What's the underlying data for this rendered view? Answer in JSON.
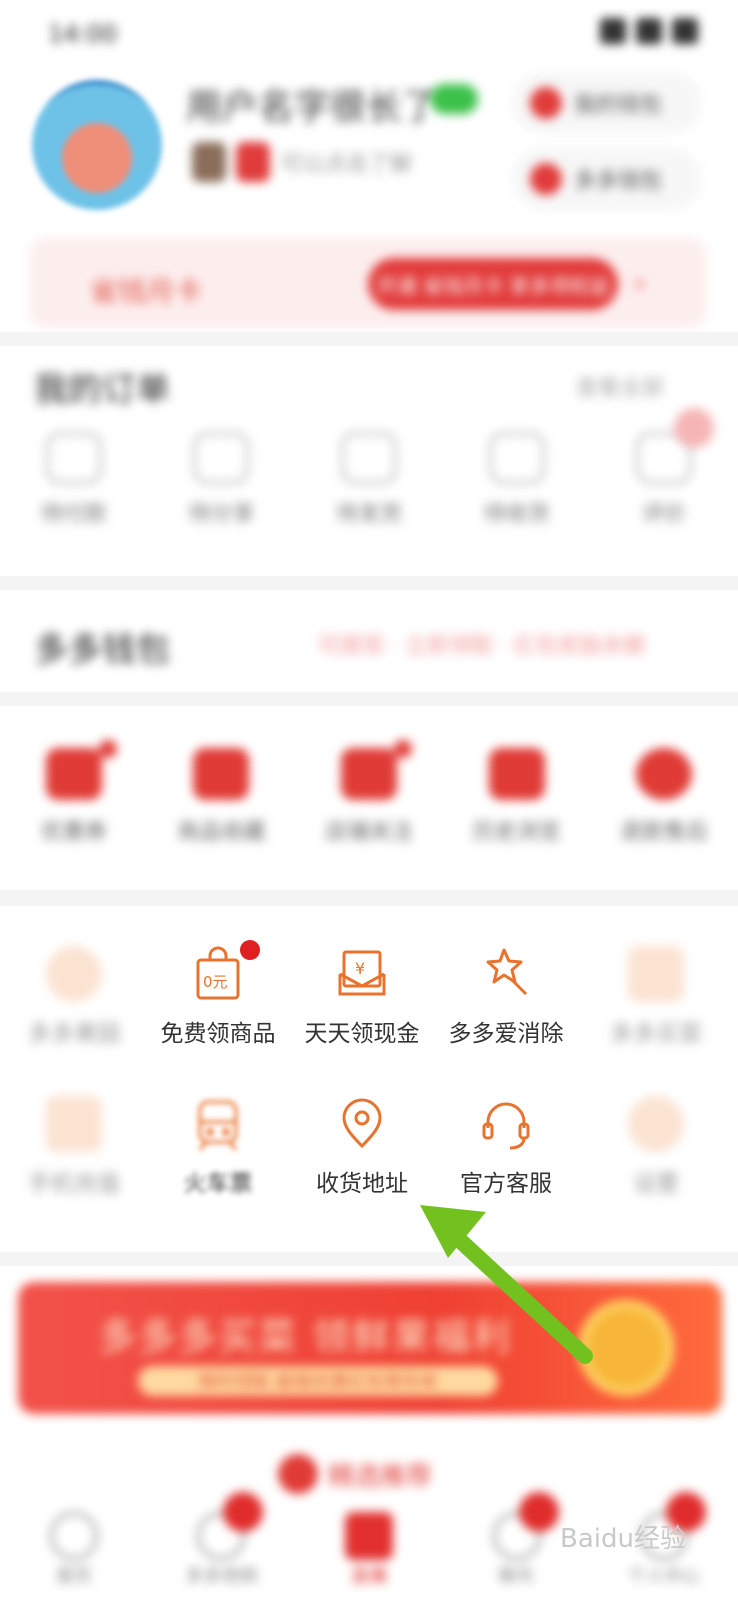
{
  "status_bar": {
    "time": "14:00"
  },
  "profile": {
    "nickname": "用户名字很长了",
    "sub_text": "可以点击了解",
    "pill_1": "我的钱包",
    "pill_2": "多多钱包"
  },
  "promo": {
    "text": "省钱月卡",
    "button": "开通 省钱月卡 享多项权益"
  },
  "orders": {
    "title": "我的订单",
    "view_all": "查看全部",
    "items": [
      "待付款",
      "待分享",
      "待发货",
      "待收货",
      "评价"
    ]
  },
  "duoduo": {
    "title": "多多钱包",
    "tags": "可提现 · 立即领取 · 红包奖励余额"
  },
  "quick_row": {
    "items": [
      "优惠券",
      "商品收藏",
      "店铺关注",
      "历史浏览",
      "退款售后"
    ]
  },
  "services": {
    "row1": [
      "多多果园",
      "免费领商品",
      "天天领现金",
      "多多爱消除",
      "多多买菜"
    ],
    "row2": [
      "手机充值",
      "火车票",
      "收货地址",
      "官方客服",
      "设置"
    ]
  },
  "big_banner": {
    "title": "多多多买菜 领鲜果福利",
    "strip": "限时领取 超值优惠红包等你来"
  },
  "recommend": "精选推荐",
  "tabbar": [
    "首页",
    "多多视频",
    "直播",
    "聊天",
    "个人中心"
  ],
  "watermark": "Baidu经验",
  "colors": {
    "accent": "#e23b3b",
    "orange_icon": "#e8732f",
    "arrow": "#72c11e"
  }
}
